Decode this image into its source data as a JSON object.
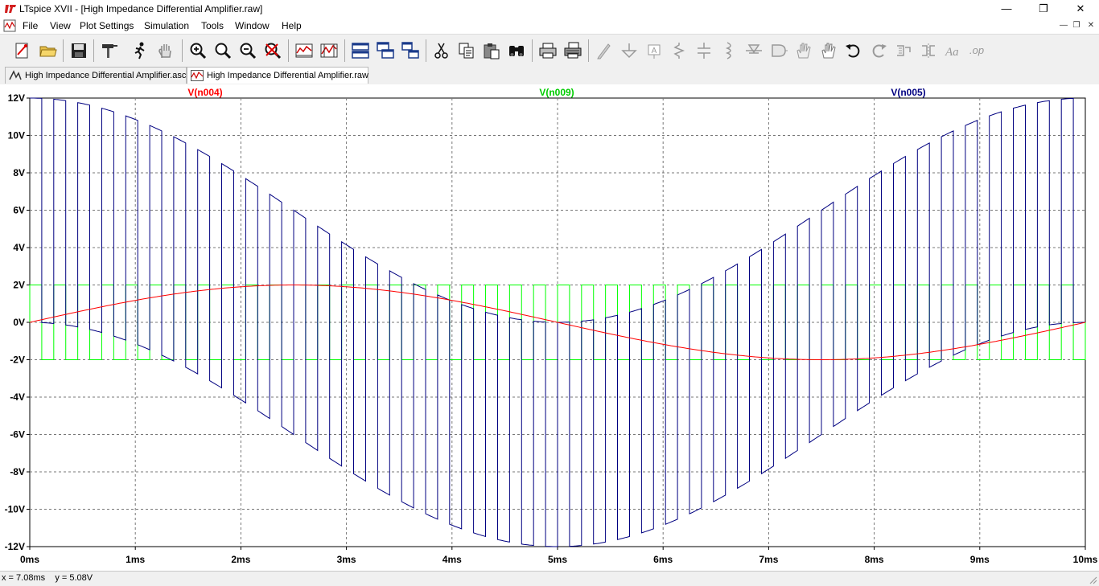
{
  "window": {
    "title": "LTspice XVII - [High Impedance Differential Amplifier.raw]"
  },
  "menu": {
    "items": [
      "File",
      "View",
      "Plot Settings",
      "Simulation",
      "Tools",
      "Window",
      "Help"
    ]
  },
  "toolbar": {
    "buttons": [
      "new-schematic",
      "open",
      "save",
      "control-panel",
      "run",
      "halt",
      "zoom-in",
      "zoom-to-fit",
      "zoom-out",
      "cancel-zoom",
      "autorange",
      "plot-settings",
      "tile-horizontal",
      "cascade",
      "tile-vertical",
      "cut",
      "copy",
      "paste",
      "find",
      "print",
      "print-setup",
      "draw-wire",
      "ground",
      "label-net",
      "resistor",
      "capacitor",
      "inductor",
      "diode",
      "component",
      "move",
      "drag",
      "undo",
      "redo",
      "rotate",
      "mirror",
      "text",
      "spice-directive"
    ]
  },
  "tabs": [
    {
      "label": "High Impedance Differential Amplifier.asc",
      "active": false
    },
    {
      "label": "High Impedance Differential Amplifier.raw",
      "active": true
    }
  ],
  "chart_data": {
    "type": "line",
    "xlabel": "",
    "ylabel": "",
    "xlim": [
      0,
      10
    ],
    "ylim": [
      -12,
      12
    ],
    "x_ticks": [
      "0ms",
      "1ms",
      "2ms",
      "3ms",
      "4ms",
      "5ms",
      "6ms",
      "7ms",
      "8ms",
      "9ms",
      "10ms"
    ],
    "y_ticks": [
      "12V",
      "10V",
      "8V",
      "6V",
      "4V",
      "2V",
      "0V",
      "-2V",
      "-4V",
      "-6V",
      "-8V",
      "-10V",
      "-12V"
    ],
    "grid": true,
    "series": [
      {
        "name": "V(n004)",
        "color": "#ff0000",
        "kind": "sine",
        "amplitude": 2,
        "period_ms": 10,
        "phase": 0,
        "x_unit": "ms",
        "y_unit": "V"
      },
      {
        "name": "V(n009)",
        "color": "#00ff00",
        "kind": "square",
        "amplitude": 2,
        "cycles": 44,
        "x_unit": "ms",
        "y_unit": "V"
      },
      {
        "name": "V(n005)",
        "color": "#000080",
        "kind": "chopped-sine",
        "envelope_offset": 0,
        "envelope_amplitude": 6,
        "sine_amplitude": 6,
        "period_ms": 10,
        "phase_deg": 90,
        "cycles": 44,
        "x_unit": "ms",
        "y_unit": "V"
      }
    ]
  },
  "status": {
    "text": "x = 7.08ms    y = 5.08V"
  }
}
